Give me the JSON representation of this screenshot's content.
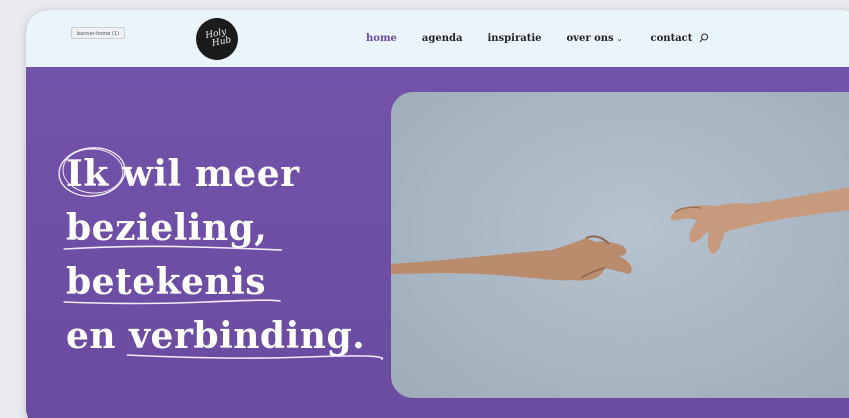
{
  "file_tag": "banner-home (1)",
  "logo": {
    "line1": "Holy",
    "line2": "Hub"
  },
  "nav": {
    "home": "home",
    "agenda": "agenda",
    "inspiratie": "inspiratie",
    "over_ons": "over ons",
    "contact": "contact"
  },
  "headline": {
    "line1_word1": "Ik",
    "line1_rest": " wil meer",
    "line2": "bezieling,",
    "line3": "betekenis",
    "line4_prefix": "en ",
    "line4_word": "verbinding."
  },
  "colors": {
    "hero_purple": "#6e4fa5",
    "header_bg": "#eaf4fb",
    "active_nav": "#6b4aa6"
  },
  "icons": {
    "search": "search-icon",
    "chevron": "chevron-down-icon"
  }
}
